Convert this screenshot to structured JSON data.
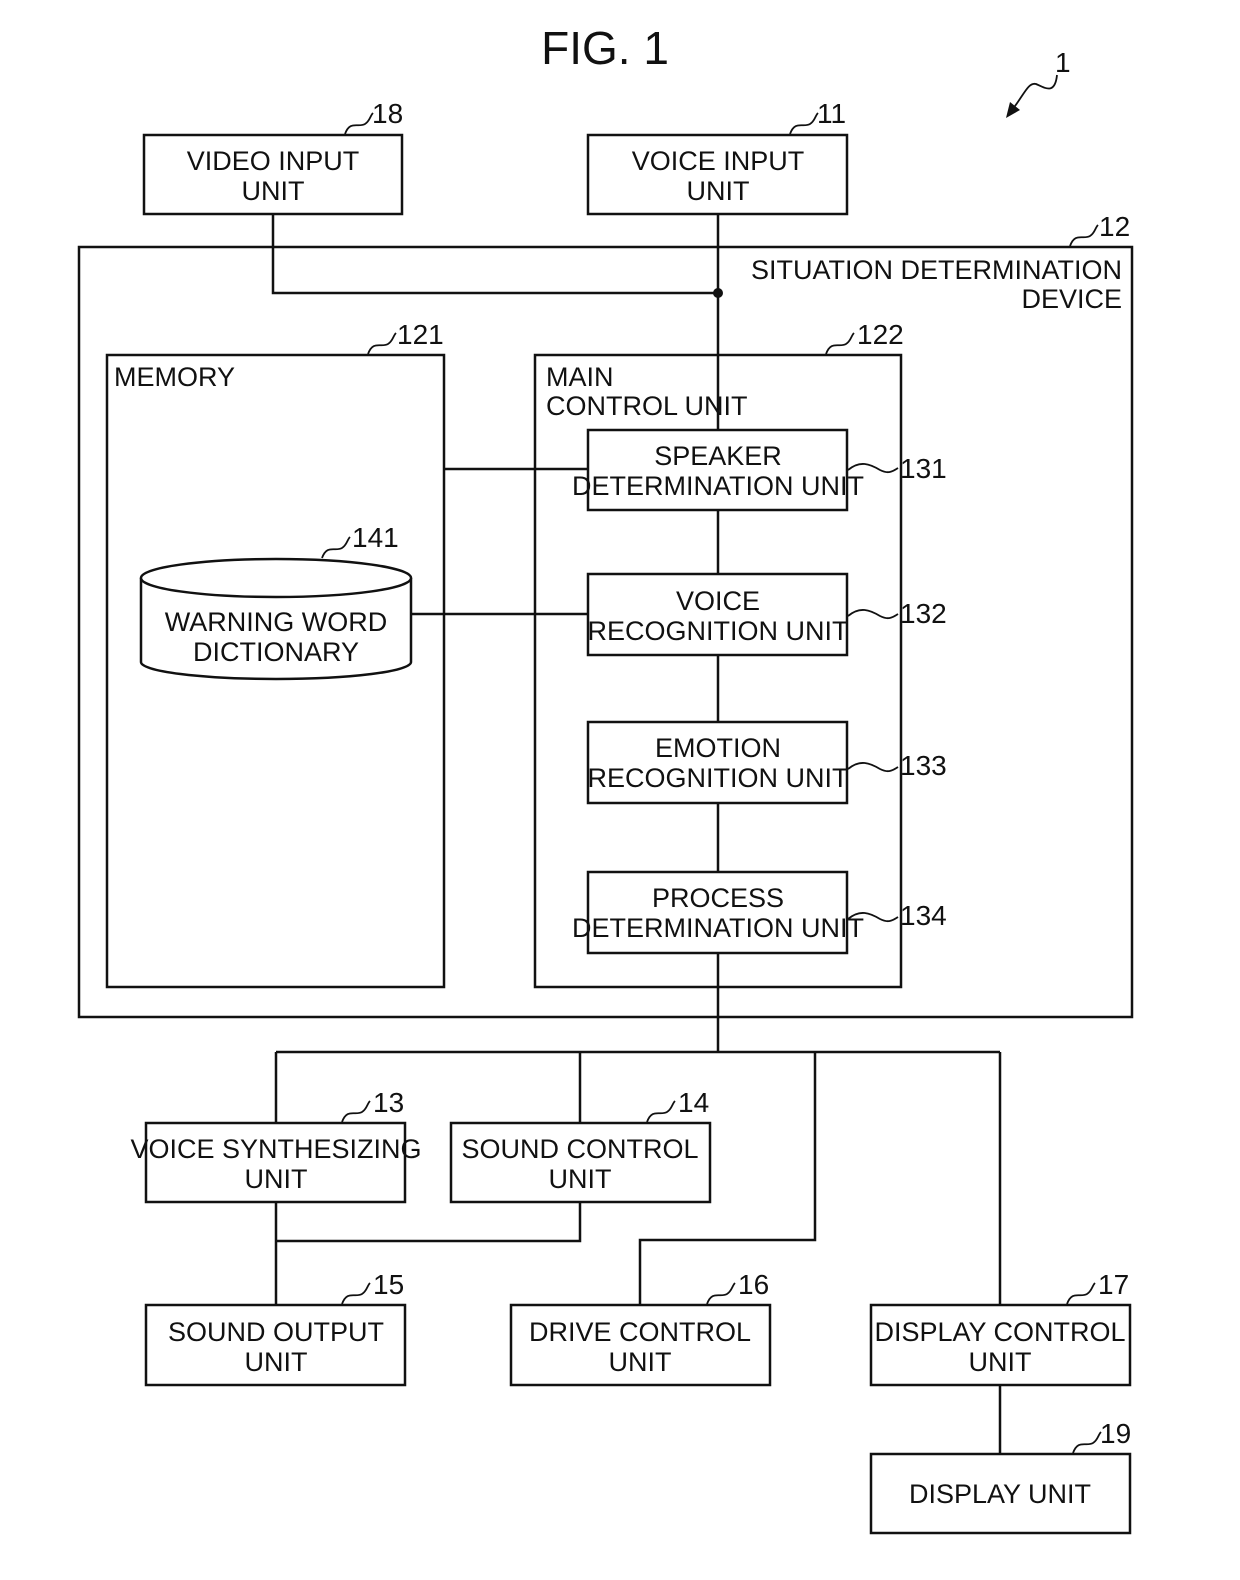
{
  "figure": {
    "title": "FIG. 1",
    "system_ref": "1"
  },
  "blocks": {
    "video_input": {
      "ref": "18",
      "lines": [
        "VIDEO INPUT",
        "UNIT"
      ]
    },
    "voice_input": {
      "ref": "11",
      "lines": [
        "VOICE INPUT",
        "UNIT"
      ]
    },
    "situation_device": {
      "ref": "12",
      "lines": [
        "SITUATION DETERMINATION",
        "DEVICE"
      ]
    },
    "memory": {
      "ref": "121",
      "lines": [
        "MEMORY"
      ]
    },
    "warning_dictionary": {
      "ref": "141",
      "lines": [
        "WARNING WORD",
        "DICTIONARY"
      ]
    },
    "main_control": {
      "ref": "122",
      "lines": [
        "MAIN",
        "CONTROL UNIT"
      ]
    },
    "speaker_determination": {
      "ref": "131",
      "lines": [
        "SPEAKER",
        "DETERMINATION UNIT"
      ]
    },
    "voice_recognition": {
      "ref": "132",
      "lines": [
        "VOICE",
        "RECOGNITION UNIT"
      ]
    },
    "emotion_recognition": {
      "ref": "133",
      "lines": [
        "EMOTION",
        "RECOGNITION UNIT"
      ]
    },
    "process_determination": {
      "ref": "134",
      "lines": [
        "PROCESS",
        "DETERMINATION UNIT"
      ]
    },
    "voice_synthesizing": {
      "ref": "13",
      "lines": [
        "VOICE SYNTHESIZING",
        "UNIT"
      ]
    },
    "sound_control": {
      "ref": "14",
      "lines": [
        "SOUND CONTROL",
        "UNIT"
      ]
    },
    "sound_output": {
      "ref": "15",
      "lines": [
        "SOUND OUTPUT",
        "UNIT"
      ]
    },
    "drive_control": {
      "ref": "16",
      "lines": [
        "DRIVE CONTROL",
        "UNIT"
      ]
    },
    "display_control": {
      "ref": "17",
      "lines": [
        "DISPLAY CONTROL",
        "UNIT"
      ]
    },
    "display_unit": {
      "ref": "19",
      "lines": [
        "DISPLAY UNIT"
      ]
    }
  }
}
